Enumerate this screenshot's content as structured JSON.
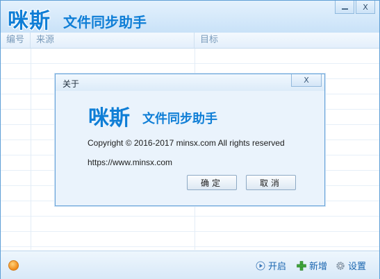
{
  "app": {
    "logo_main": "咪斯",
    "logo_sub": "文件同步助手",
    "minimize_label": "",
    "close_label": "X"
  },
  "table": {
    "columns": [
      "编号",
      "来源",
      "目标"
    ]
  },
  "toolbar": {
    "start_label": "开启",
    "add_label": "新增",
    "settings_label": "设置"
  },
  "dialog": {
    "title": "关于",
    "close_label": "X",
    "logo_main": "咪斯",
    "logo_sub": "文件同步助手",
    "copyright": "Copyright © 2016-2017 minsx.com All rights reserved",
    "url": "https://www.minsx.com",
    "ok_label": "确定",
    "cancel_label": "取消"
  },
  "colors": {
    "brand": "#0f7ed6",
    "accent": "#1a66b0"
  }
}
